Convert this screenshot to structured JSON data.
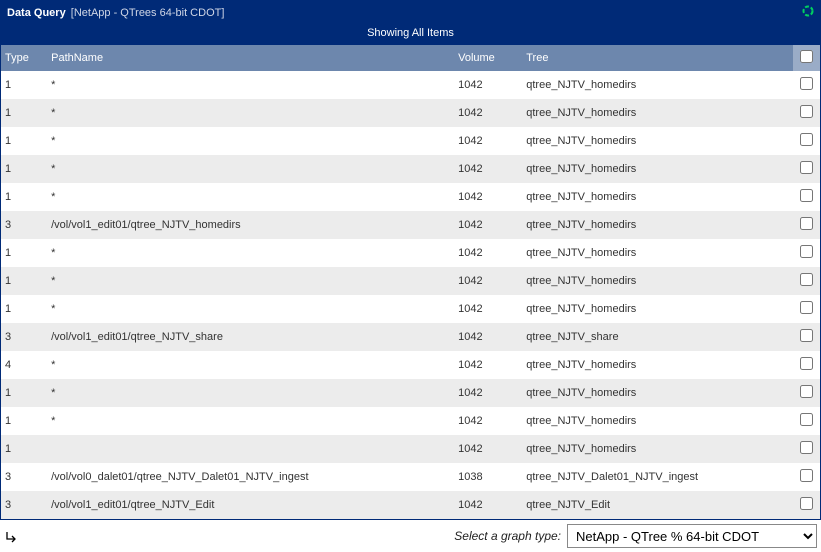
{
  "header": {
    "title": "Data Query",
    "subtitle": "[NetApp - QTrees 64-bit CDOT]",
    "status_icon": "loading-spinner"
  },
  "subheader": "Showing All Items",
  "columns": {
    "type": "Type",
    "path": "PathName",
    "volume": "Volume",
    "tree": "Tree"
  },
  "rows": [
    {
      "type": "1",
      "path": "*",
      "volume": "1042",
      "tree": "qtree_NJTV_homedirs"
    },
    {
      "type": "1",
      "path": "*",
      "volume": "1042",
      "tree": "qtree_NJTV_homedirs"
    },
    {
      "type": "1",
      "path": "*",
      "volume": "1042",
      "tree": "qtree_NJTV_homedirs"
    },
    {
      "type": "1",
      "path": "*",
      "volume": "1042",
      "tree": "qtree_NJTV_homedirs"
    },
    {
      "type": "1",
      "path": "*",
      "volume": "1042",
      "tree": "qtree_NJTV_homedirs"
    },
    {
      "type": "3",
      "path": "/vol/vol1_edit01/qtree_NJTV_homedirs",
      "volume": "1042",
      "tree": "qtree_NJTV_homedirs"
    },
    {
      "type": "1",
      "path": "*",
      "volume": "1042",
      "tree": "qtree_NJTV_homedirs"
    },
    {
      "type": "1",
      "path": "*",
      "volume": "1042",
      "tree": "qtree_NJTV_homedirs"
    },
    {
      "type": "1",
      "path": "*",
      "volume": "1042",
      "tree": "qtree_NJTV_homedirs"
    },
    {
      "type": "3",
      "path": "/vol/vol1_edit01/qtree_NJTV_share",
      "volume": "1042",
      "tree": "qtree_NJTV_share"
    },
    {
      "type": "4",
      "path": "*",
      "volume": "1042",
      "tree": "qtree_NJTV_homedirs"
    },
    {
      "type": "1",
      "path": "*",
      "volume": "1042",
      "tree": "qtree_NJTV_homedirs"
    },
    {
      "type": "1",
      "path": "*",
      "volume": "1042",
      "tree": "qtree_NJTV_homedirs"
    },
    {
      "type": "1",
      "path": "",
      "volume": "1042",
      "tree": "qtree_NJTV_homedirs"
    },
    {
      "type": "3",
      "path": "/vol/vol0_dalet01/qtree_NJTV_Dalet01_NJTV_ingest",
      "volume": "1038",
      "tree": "qtree_NJTV_Dalet01_NJTV_ingest"
    },
    {
      "type": "3",
      "path": "/vol/vol1_edit01/qtree_NJTV_Edit",
      "volume": "1042",
      "tree": "qtree_NJTV_Edit"
    }
  ],
  "footer": {
    "label": "Select a graph type:",
    "selected": "NetApp - QTree % 64-bit CDOT"
  }
}
